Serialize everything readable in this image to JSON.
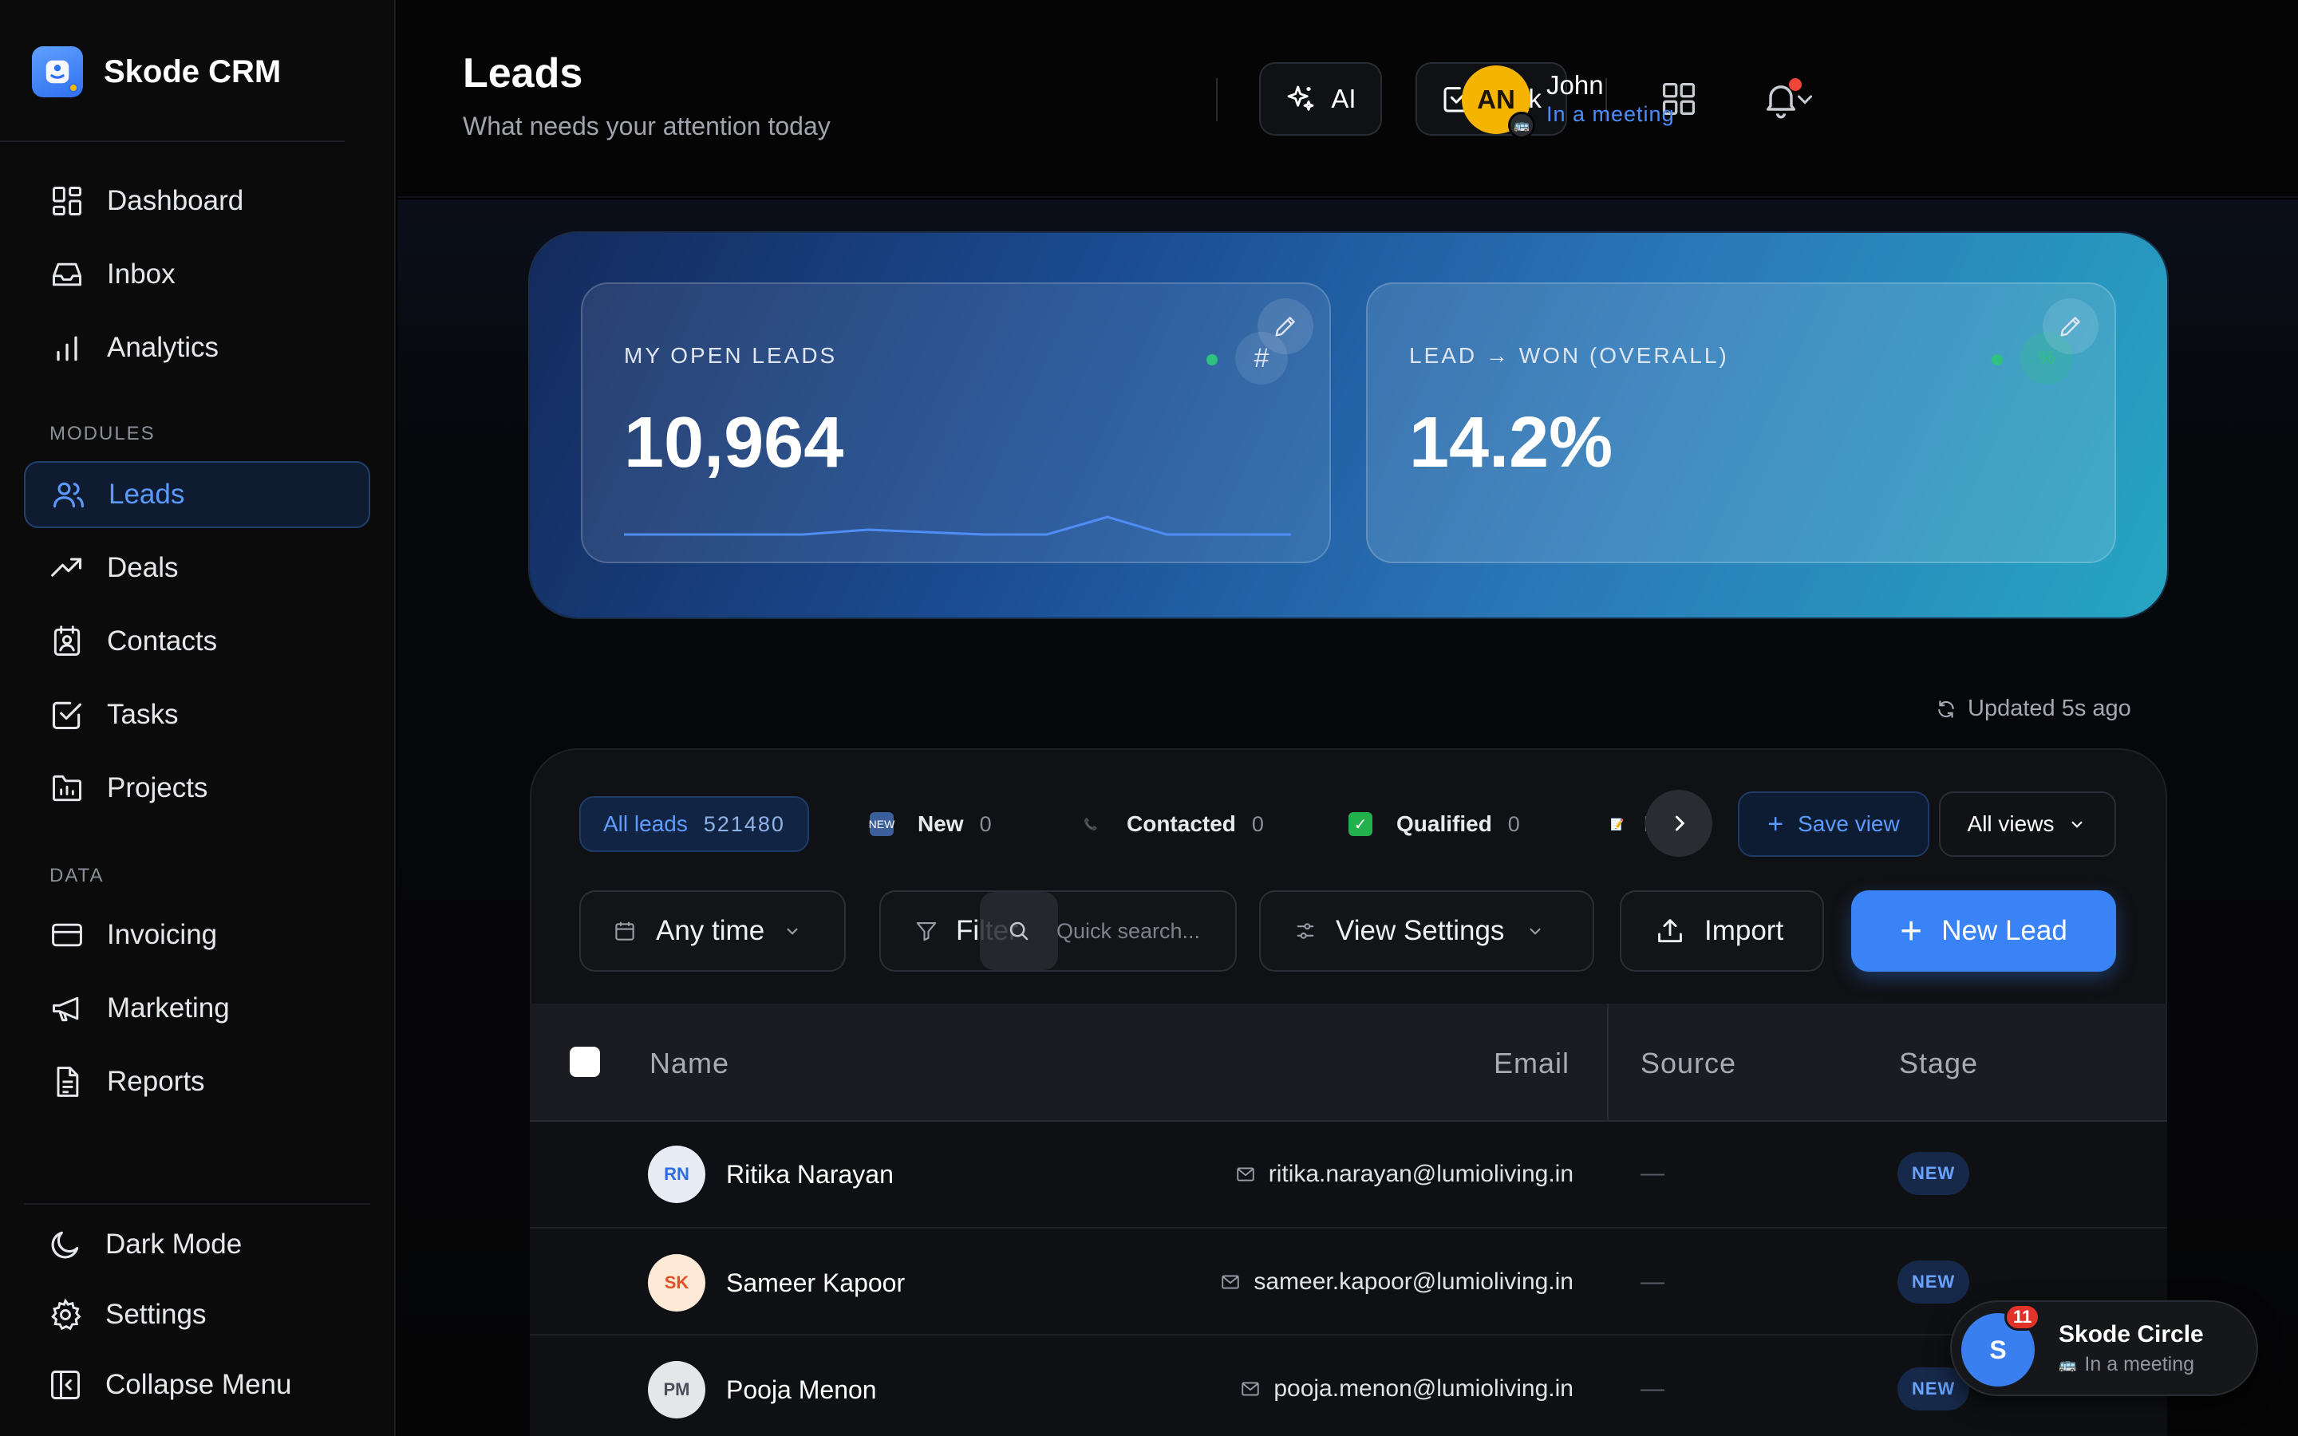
{
  "app": {
    "name": "Skode CRM"
  },
  "sidebar": {
    "items": [
      {
        "label": "Dashboard",
        "icon": "dashboard-icon"
      },
      {
        "label": "Inbox",
        "icon": "inbox-icon"
      },
      {
        "label": "Analytics",
        "icon": "analytics-icon"
      },
      {
        "label": "Leads",
        "icon": "users-icon",
        "active": true
      },
      {
        "label": "Deals",
        "icon": "trend-icon"
      },
      {
        "label": "Contacts",
        "icon": "contacts-icon"
      },
      {
        "label": "Tasks",
        "icon": "check-square-icon"
      },
      {
        "label": "Projects",
        "icon": "folder-chart-icon"
      },
      {
        "label": "Invoicing",
        "icon": "card-icon"
      },
      {
        "label": "Marketing",
        "icon": "megaphone-icon"
      },
      {
        "label": "Reports",
        "icon": "report-icon"
      }
    ],
    "sections": {
      "modules": "MODULES",
      "data": "DATA"
    },
    "footer": {
      "dark_mode": "Dark Mode",
      "settings": "Settings",
      "collapse": "Collapse Menu"
    }
  },
  "header": {
    "title": "Leads",
    "subtitle": "What needs your attention today",
    "ai_label": "AI",
    "task_label": "Task",
    "user": {
      "initials": "AN",
      "name": "John",
      "status": "In a meeting"
    }
  },
  "kpis": [
    {
      "label": "MY OPEN LEADS",
      "value": "10,964"
    },
    {
      "label": "LEAD → WON (OVERALL)",
      "value": "14.2%"
    }
  ],
  "updated": "Updated 5s ago",
  "filters": {
    "chips": [
      {
        "label": "All leads",
        "count": "521480"
      },
      {
        "label": "New",
        "count": "0",
        "emoji": "🆕"
      },
      {
        "label": "Contacted",
        "count": "0",
        "emoji": "📞"
      },
      {
        "label": "Qualified",
        "count": "0",
        "emoji": "✅"
      },
      {
        "label": "Pr",
        "emoji": "📝"
      }
    ],
    "save_view": "Save view",
    "all_views": "All views"
  },
  "toolbar": {
    "time": "Any time",
    "filter": "Filter",
    "search_placeholder": "Quick search...",
    "view_settings": "View Settings",
    "import": "Import",
    "new_lead": "New Lead"
  },
  "table": {
    "columns": [
      "Name",
      "Email",
      "Source",
      "Stage"
    ],
    "rows": [
      {
        "initials": "RN",
        "name": "Ritika Narayan",
        "email": "ritika.narayan@lumioliving.in",
        "source": "—",
        "stage": "NEW"
      },
      {
        "initials": "SK",
        "name": "Sameer Kapoor",
        "email": "sameer.kapoor@lumioliving.in",
        "source": "—",
        "stage": "NEW"
      },
      {
        "initials": "PM",
        "name": "Pooja Menon",
        "email": "pooja.menon@lumioliving.in",
        "source": "—",
        "stage": "NEW"
      }
    ]
  },
  "circle": {
    "initial": "S",
    "badge": "11",
    "title": "Skode Circle",
    "status": "In a meeting"
  },
  "colors": {
    "accent": "#3a83f6",
    "notification": "#f04438",
    "avatar": "#f5b400",
    "status_online": "#2ec27e"
  }
}
